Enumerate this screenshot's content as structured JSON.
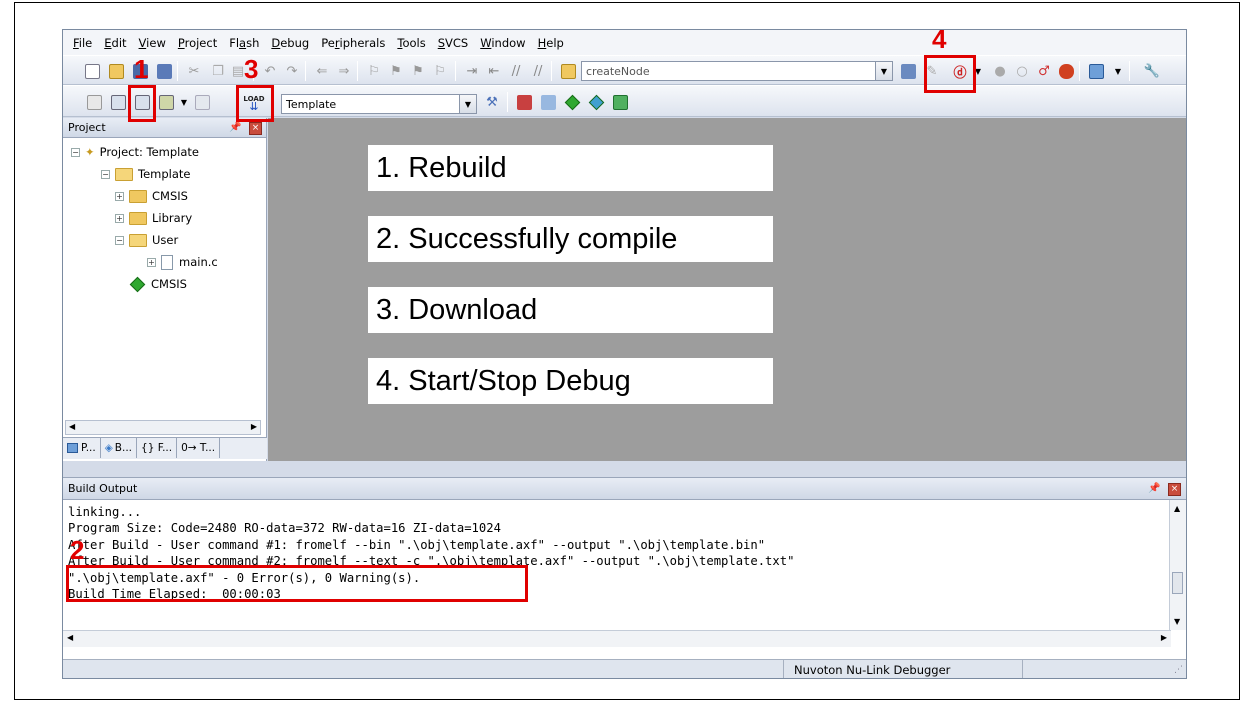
{
  "menu": [
    {
      "pre": "",
      "u": "F",
      "post": "ile"
    },
    {
      "pre": "",
      "u": "E",
      "post": "dit"
    },
    {
      "pre": "",
      "u": "V",
      "post": "iew"
    },
    {
      "pre": "",
      "u": "P",
      "post": "roject"
    },
    {
      "pre": "Fl",
      "u": "a",
      "post": "sh"
    },
    {
      "pre": "",
      "u": "D",
      "post": "ebug"
    },
    {
      "pre": "Pe",
      "u": "r",
      "post": "ipherals"
    },
    {
      "pre": "",
      "u": "T",
      "post": "ools"
    },
    {
      "pre": "",
      "u": "S",
      "post": "VCS"
    },
    {
      "pre": "",
      "u": "W",
      "post": "indow"
    },
    {
      "pre": "",
      "u": "H",
      "post": "elp"
    }
  ],
  "toolbar": {
    "find_combo_value": "createNode",
    "target_combo_value": "Template",
    "load_label": "LOAD"
  },
  "project": {
    "panel_title": "Project",
    "tree": {
      "root": "Project: Template",
      "target": "Template",
      "group_cmsis": "CMSIS",
      "group_library": "Library",
      "group_user": "User",
      "file_main": "main.c",
      "component_cmsis": "CMSIS"
    },
    "tabs": [
      "P...",
      "B...",
      "{} F...",
      "0→ T..."
    ]
  },
  "notes": {
    "n1": "1. Rebuild",
    "n2": "2. Successfully compile",
    "n3": "3. Download",
    "n4": "4. Start/Stop Debug"
  },
  "build": {
    "title": "Build Output",
    "lines": [
      "linking...",
      "Program Size: Code=2480 RO-data=372 RW-data=16 ZI-data=1024",
      "After Build - User command #1: fromelf --bin \".\\obj\\template.axf\" --output \".\\obj\\template.bin\"",
      "After Build - User command #2: fromelf --text -c \".\\obj\\template.axf\" --output \".\\obj\\template.txt\"",
      "\".\\obj\\template.axf\" - 0 Error(s), 0 Warning(s).",
      "Build Time Elapsed:  00:00:03"
    ]
  },
  "status": {
    "debugger": "Nuvoton Nu-Link Debugger"
  },
  "callouts": {
    "c1": "1",
    "c2": "2",
    "c3": "3",
    "c4": "4"
  },
  "colors": {
    "callout_red": "#e00000",
    "editor_gray": "#9d9d9d"
  }
}
